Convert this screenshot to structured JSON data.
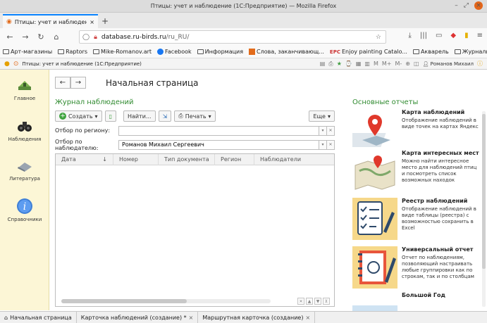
{
  "window": {
    "title": "Птицы: учет и наблюдение (1С:Предприятие) — Mozilla Firefox"
  },
  "browser": {
    "tab_title": "Птицы: учет и наблюдени",
    "url_host": "database.ru-birds.ru",
    "url_path": "/ru_RU/",
    "bookmarks": [
      "Арт-магазины",
      "Raptors",
      "Mike-Romanov.art",
      "Facebook",
      "Информация",
      "Слова, заканчивающ...",
      "Enjoy painting Catalo...",
      "Акварель",
      "Журналы"
    ]
  },
  "app": {
    "title": "Птицы: учет и наблюдение (1С:Предприятие)",
    "user": "Романов Михаил",
    "memory_buttons": [
      "M",
      "M+",
      "M-"
    ]
  },
  "sidebar": {
    "items": [
      {
        "label": "Главное"
      },
      {
        "label": "Наблюдения"
      },
      {
        "label": "Литература"
      },
      {
        "label": "Справочники"
      }
    ]
  },
  "main": {
    "page_title": "Начальная страница",
    "journal": {
      "title": "Журнал наблюдений",
      "create_label": "Создать",
      "find_label": "Найти...",
      "print_label": "Печать",
      "more_label": "Еще",
      "region_filter_label": "Отбор по региону:",
      "region_filter_value": "",
      "observer_filter_label": "Отбор по наблюдателю:",
      "observer_filter_value": "Романов Михаил Сергеевич",
      "columns": [
        "Дата",
        "Номер",
        "Тип документа",
        "Регион",
        "Наблюдатели"
      ]
    },
    "reports": {
      "title": "Основные отчеты",
      "items": [
        {
          "title": "Карта наблюдений",
          "desc": "Отображение наблюдений в виде точек на картах Яндекс"
        },
        {
          "title": "Карта интересных мест",
          "desc": "Можно найти интересное место для наблюдений птиц и посмотреть список возможных находок"
        },
        {
          "title": "Реестр наблюдений",
          "desc": "Отображение наблюдений в виде таблицы (реестра) с возможностью сохранить в Excel"
        },
        {
          "title": "Универсальный отчет",
          "desc": "Отчет по наблюдениям, позволяющий настраивать любые группировки как по строкам, так и по столбцам"
        },
        {
          "title": "Большой Год",
          "desc": ""
        }
      ]
    }
  },
  "bottom_tabs": [
    "Начальная страница",
    "Карточка наблюдений (создание) *",
    "Маршрутная карточка (создание)"
  ],
  "colors": {
    "accent_green": "#2f8a2f",
    "sidebar_bg": "#fcf6d6",
    "firefox_tab": "#0a84ff"
  }
}
